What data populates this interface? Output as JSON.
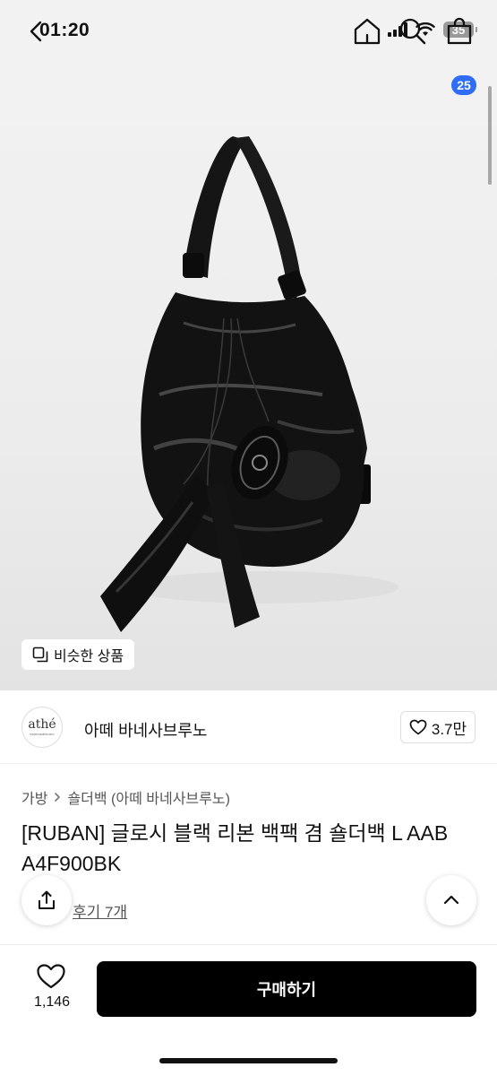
{
  "status_bar": {
    "time": "01:20",
    "battery": "35",
    "icons": [
      "signal-icon",
      "wifi-icon",
      "battery-icon"
    ]
  },
  "nav": {
    "icons": [
      "back-icon",
      "home-icon",
      "search-icon",
      "cart-icon"
    ],
    "cart_count": "25"
  },
  "product_image": {
    "similar_label": "비슷한 상품",
    "similar_icon": "similar-items-icon"
  },
  "brand": {
    "logo_text": "athé",
    "logo_subtext": "vanessabruno",
    "name": "아떼 바네사브루노",
    "like_icon": "heart-outline-icon",
    "like_count": "3.7만"
  },
  "breadcrumb": {
    "category": "가방",
    "separator_icon": "chevron-right-icon",
    "subcategory": "숄더백 (아떼 바네사브루노)"
  },
  "product": {
    "title": "[RUBAN] 글로시 블랙 리본 백팩 겸 숄더백 L AAB A4F900BK",
    "reviews": "후기 7개"
  },
  "floating": {
    "share_icon": "share-icon",
    "scroll_top_icon": "chevron-up-icon"
  },
  "bottom_bar": {
    "wish_icon": "heart-outline-icon",
    "wish_count": "1,146",
    "buy_label": "구매하기"
  },
  "colors": {
    "header_bg": "#f2f2f2",
    "badge": "#2f6df6",
    "buy_button": "#000000",
    "bag": "#121212"
  }
}
